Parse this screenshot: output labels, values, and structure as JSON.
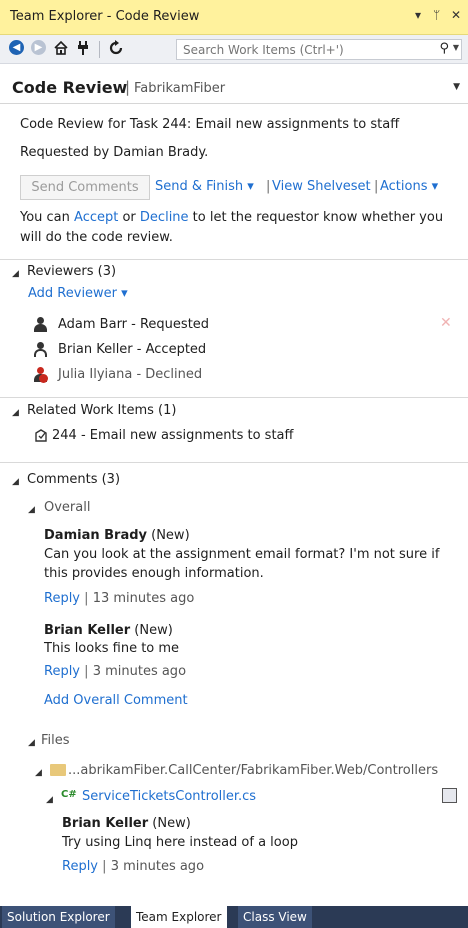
{
  "window": {
    "title": "Team Explorer - Code Review",
    "dropdown_glyph": "▾",
    "pin_glyph": "ᛘ",
    "close_glyph": "✕"
  },
  "toolbar": {
    "search_placeholder": "Search Work Items (Ctrl+')",
    "search_icon": "⚲",
    "search_dropdown": "▼"
  },
  "header": {
    "title": "Code Review",
    "separator": "|",
    "project": "FabrikamFiber",
    "dropdown": "▼"
  },
  "summary": {
    "line1": "Code Review for Task 244: Email new assignments to staff",
    "line2": "Requested by Damian Brady."
  },
  "actions": {
    "send_comments": "Send Comments",
    "send_finish": "Send & Finish ▾",
    "view_shelveset": "View Shelveset",
    "actions_menu": "Actions ▾",
    "sep": "|"
  },
  "notice": {
    "prefix": "You can ",
    "accept": "Accept",
    "or": " or ",
    "decline": "Decline",
    "suffix1": " to let the requestor know whether you",
    "line2": "will do the code review."
  },
  "reviewers": {
    "header": "Reviewers (3)",
    "add": "Add Reviewer ▾",
    "items": [
      {
        "label": "Adam Barr - Requested"
      },
      {
        "label": "Brian Keller - Accepted"
      },
      {
        "label": "Julia Ilyiana - Declined"
      }
    ],
    "remove_glyph": "✕"
  },
  "related": {
    "header": "Related Work Items (1)",
    "items": [
      {
        "label": "244 - Email new assignments to staff"
      }
    ]
  },
  "comments": {
    "header": "Comments (3)",
    "overall_header": "Overall",
    "overall": [
      {
        "author": "Damian Brady",
        "status": "(New)",
        "text1": "Can you look at the assignment email format? I'm not sure if",
        "text2": "this provides enough information.",
        "reply": "Reply",
        "time": "13 minutes ago"
      },
      {
        "author": "Brian Keller",
        "status": "(New)",
        "text1": "This looks fine to me",
        "reply": "Reply",
        "time": "3 minutes ago"
      }
    ],
    "add_overall": "Add Overall Comment",
    "files_header": "Files",
    "folder_path": "...abrikamFiber.CallCenter/FabrikamFiber.Web/Controllers",
    "file_name": "ServiceTicketsController.cs",
    "file_badge": "C#",
    "file_comment": {
      "author": "Brian Keller",
      "status": "(New)",
      "text1": "Try using Linq here instead of a loop",
      "reply": "Reply",
      "time": "3 minutes ago"
    }
  },
  "bottom_tabs": [
    "Solution Explorer",
    "Team Explorer",
    "Class View"
  ],
  "expanded_glyph": "◢",
  "colors": {
    "title_bar": "#fff29d",
    "link": "#1f6fd0",
    "tab_bar": "#2b3a55",
    "decline_red": "#c8281e",
    "remove_x": "#f0b3b3"
  }
}
